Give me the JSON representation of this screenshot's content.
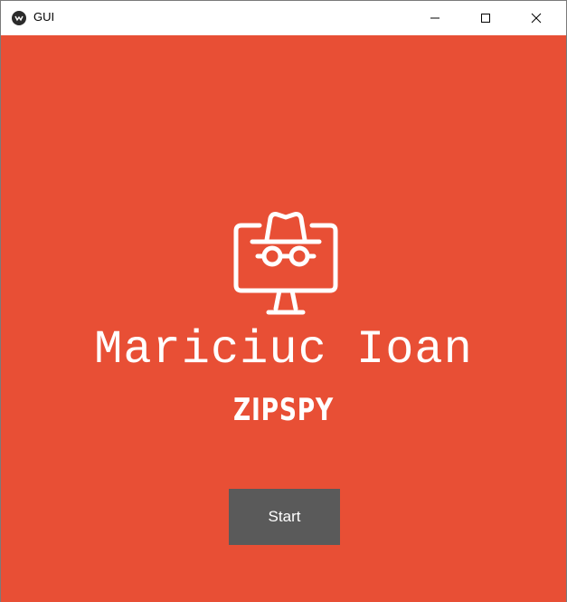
{
  "window": {
    "title": "GUI",
    "controls": [
      "minimize-icon",
      "maximize-icon",
      "close-icon"
    ]
  },
  "main": {
    "background_color": "#e84f35",
    "logo_icon": "incognito-monitor-icon",
    "name": "Mariciuc Ioan",
    "brand": "ZIPSPY",
    "start_button_label": "Start",
    "start_button_color": "#5a5a5a"
  }
}
